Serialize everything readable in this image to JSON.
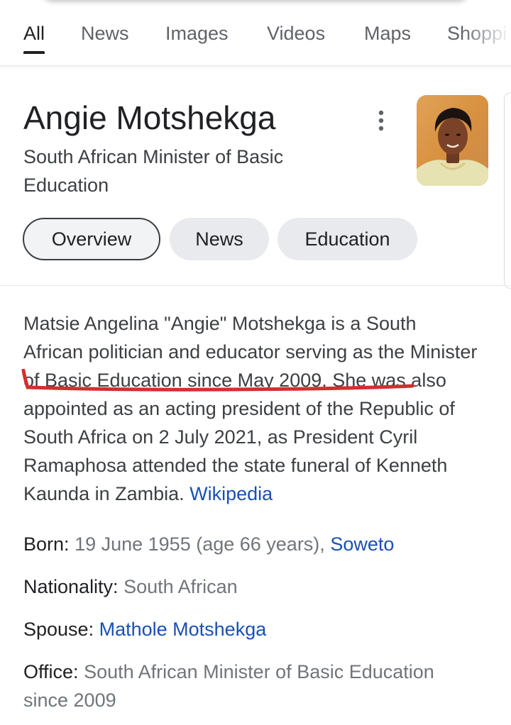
{
  "tabs": [
    {
      "label": "All",
      "active": true
    },
    {
      "label": "News",
      "active": false
    },
    {
      "label": "Images",
      "active": false
    },
    {
      "label": "Videos",
      "active": false
    },
    {
      "label": "Maps",
      "active": false
    },
    {
      "label": "Shoppi",
      "active": false
    }
  ],
  "entity": {
    "title": "Angie Motshekga",
    "subtitle": "South African Minister of Basic Education"
  },
  "chips": [
    {
      "label": "Overview",
      "selected": true
    },
    {
      "label": "News",
      "selected": false
    },
    {
      "label": "Education",
      "selected": false
    }
  ],
  "description": {
    "text": "Matsie Angelina \"Angie\" Motshekga is a South African politician and educator serving as the Minister of Basic Education since May 2009. She was also appointed as an acting president of the Republic of South Africa on 2 July 2021, as President Cyril Ramaphosa attended the state funeral of Kenneth Kaunda in Zambia.",
    "source_link": "Wikipedia"
  },
  "facts": {
    "born": {
      "label": "Born:",
      "value": "19 June 1955 (age 66 years),",
      "link": "Soweto"
    },
    "nationality": {
      "label": "Nationality:",
      "value": "South African"
    },
    "spouse": {
      "label": "Spouse:",
      "link": "Mathole Motshekga"
    },
    "office": {
      "label": "Office:",
      "value": "South African Minister of Basic Education since 2009"
    }
  },
  "colors": {
    "link": "#1a4fb5",
    "annotation": "#d32f2f",
    "chip_bg": "#e8eaed"
  },
  "icons": [
    "more-vert-icon"
  ]
}
